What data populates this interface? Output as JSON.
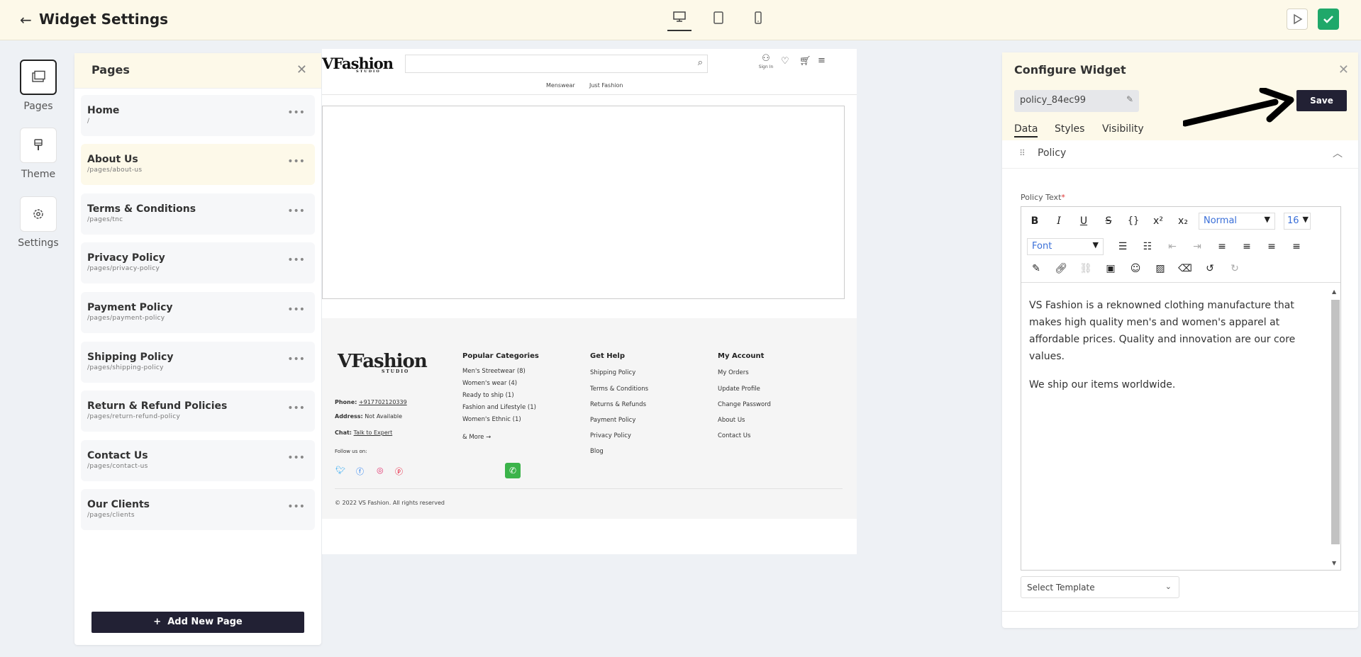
{
  "header": {
    "title": "Widget Settings",
    "back_icon": "arrow-left-icon"
  },
  "rail": {
    "pages": "Pages",
    "theme": "Theme",
    "settings": "Settings"
  },
  "pages_panel": {
    "title": "Pages",
    "items": [
      {
        "name": "Home",
        "path": "/"
      },
      {
        "name": "About Us",
        "path": "/pages/about-us"
      },
      {
        "name": "Terms & Conditions",
        "path": "/pages/tnc"
      },
      {
        "name": "Privacy Policy",
        "path": "/pages/privacy-policy"
      },
      {
        "name": "Payment Policy",
        "path": "/pages/payment-policy"
      },
      {
        "name": "Shipping Policy",
        "path": "/pages/shipping-policy"
      },
      {
        "name": "Return & Refund Policies",
        "path": "/pages/return-refund-policy"
      },
      {
        "name": "Contact Us",
        "path": "/pages/contact-us"
      },
      {
        "name": "Our Clients",
        "path": "/pages/clients"
      }
    ],
    "add_label": "Add New Page"
  },
  "preview": {
    "logo": "VFashion",
    "logo_sub": "STUDIO",
    "sign_in": "Sign In",
    "nav": [
      "Menswear",
      "Just Fashion"
    ],
    "footer": {
      "phone_label": "Phone:",
      "phone": "+917702120339",
      "address_label": "Address:",
      "address": "Not Available",
      "chat_label": "Chat:",
      "chat": "Talk to Expert",
      "follow": "Follow us on:",
      "col1_title": "Popular Categories",
      "col1": [
        "Men's Streetwear (8)",
        "Women's wear (4)",
        "Ready to ship (1)",
        "Fashion and Lifestyle (1)",
        "Women's Ethnic (1)"
      ],
      "more": "& More →",
      "col2_title": "Get Help",
      "col2": [
        "Shipping Policy",
        "Terms & Conditions",
        "Returns & Refunds",
        "Payment Policy",
        "Privacy Policy",
        "Blog"
      ],
      "col3_title": "My Account",
      "col3": [
        "My Orders",
        "Update Profile",
        "Change Password",
        "About Us",
        "Contact Us"
      ],
      "copyright": "© 2022 VS Fashion. All rights reserved"
    }
  },
  "config": {
    "title": "Configure Widget",
    "widget_id": "policy_84ec99",
    "save": "Save",
    "tabs": [
      "Data",
      "Styles",
      "Visibility"
    ],
    "section": "Policy",
    "field_label": "Policy Text",
    "required_mark": "*",
    "toolbar": {
      "format": "Normal",
      "size": "16",
      "font": "Font"
    },
    "paragraphs": [
      "VS Fashion is a reknowned clothing manufacture that makes high quality men's and women's apparel at affordable prices. Quality and innovation are our core values.",
      "We ship our items worldwide."
    ],
    "template_select": "Select Template"
  },
  "colors": {
    "header_bg": "#fdf9e9",
    "primary_button": "#222134",
    "check_green": "#1fa86a"
  }
}
